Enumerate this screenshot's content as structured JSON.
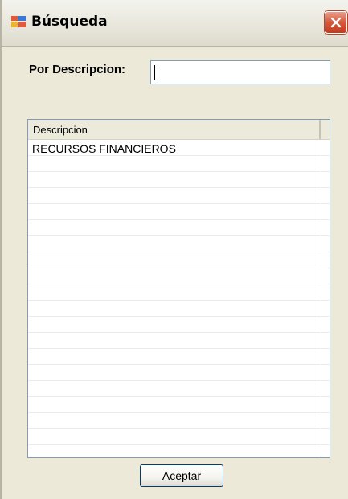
{
  "window": {
    "title": "Búsqueda",
    "app_icon": "app-window-icon",
    "close_icon": "close-icon"
  },
  "search": {
    "label": "Por Descripcion:",
    "value": "",
    "placeholder": ""
  },
  "grid": {
    "column_header": "Descripcion",
    "rows": [
      "RECURSOS FINANCIEROS"
    ]
  },
  "footer": {
    "accept_label": "Aceptar"
  },
  "colors": {
    "window_bg": "#ece9d8",
    "close_button": "#d8573a",
    "border_accent": "#7f9db9"
  }
}
